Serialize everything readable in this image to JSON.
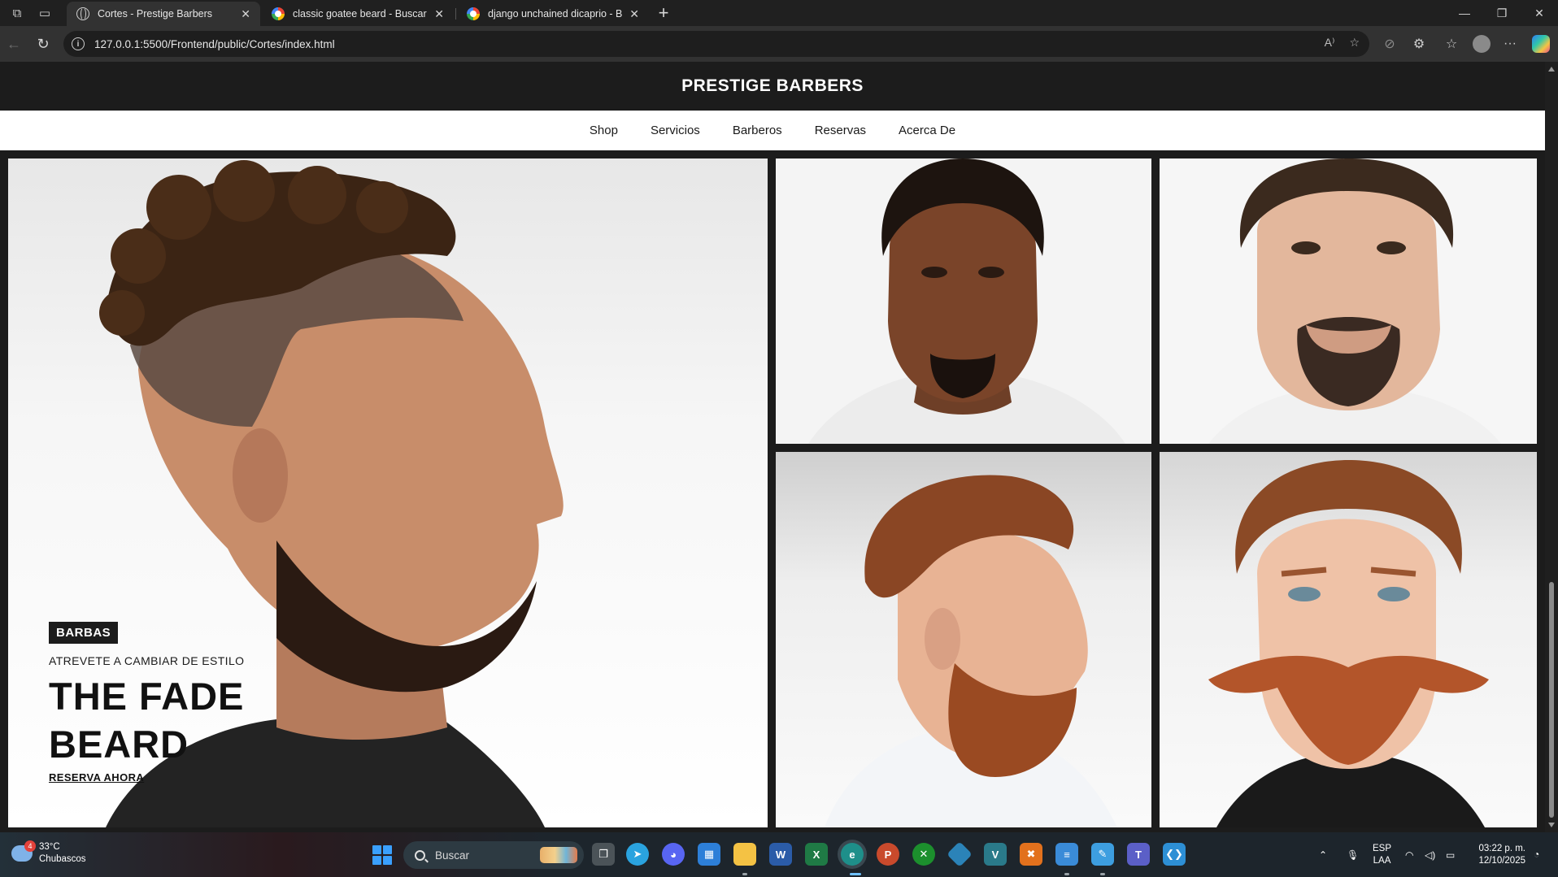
{
  "browser": {
    "tabs": [
      {
        "title": "Cortes - Prestige Barbers",
        "active": true,
        "favicon": "globe-icon"
      },
      {
        "title": "classic goatee beard - Buscar con",
        "active": false,
        "favicon": "google-icon"
      },
      {
        "title": "django unchained dicaprio - Busc",
        "active": false,
        "favicon": "google-icon"
      }
    ],
    "url": "127.0.0.1:5500/Frontend/public/Cortes/index.html"
  },
  "site": {
    "brand": "PRESTIGE BARBERS",
    "nav": [
      "Shop",
      "Servicios",
      "Barberos",
      "Reservas",
      "Acerca De"
    ],
    "hero": {
      "tag": "BARBAS",
      "kicker": "ATREVETE A CAMBIAR DE ESTILO",
      "headline_line1": "THE FADE",
      "headline_line2": "BEARD",
      "cta": "RESERVA AHORA"
    }
  },
  "taskbar": {
    "weather_temp": "33°C",
    "weather_desc": "Chubascos",
    "weather_badge": "4",
    "search_placeholder": "Buscar",
    "lang_1": "ESP",
    "lang_2": "LAA",
    "time": "03:22 p. m.",
    "date": "12/10/2025",
    "apps": [
      "task-view",
      "telegram",
      "discord",
      "microsoft-store",
      "file-explorer",
      "word",
      "excel",
      "edge",
      "powerpoint",
      "xbox",
      "kodi",
      "visual-studio",
      "xampp",
      "notepad",
      "paint",
      "teams",
      "vscode"
    ]
  },
  "colors": {
    "header_bg": "#1c1c1c",
    "nav_bg": "#ffffff",
    "accent_text": "#111111"
  }
}
